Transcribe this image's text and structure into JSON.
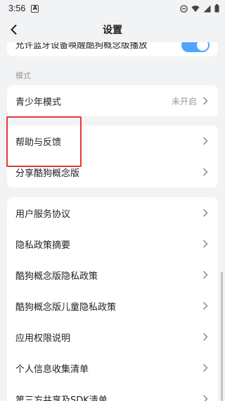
{
  "status_bar": {
    "time": "3:56",
    "alert_glyph": "A"
  },
  "header": {
    "title": "设置"
  },
  "partial_row": {
    "label": "允许蓝牙设备唤醒酷狗概念版播放"
  },
  "mode_section": {
    "label": "模式"
  },
  "teen_mode": {
    "label": "青少年模式",
    "value": "未开启"
  },
  "help_group": {
    "items": [
      "帮助与反馈",
      "分享酷狗概念版"
    ]
  },
  "legal_group": {
    "items": [
      "用户服务协议",
      "隐私政策摘要",
      "酷狗概念版隐私政策",
      "酷狗概念版儿童隐私政策",
      "应用权限说明",
      "个人信息收集清单",
      "第三方共享及SDK清单"
    ]
  },
  "colors": {
    "toggle_on": "#4fa6ff",
    "highlight": "#e53935",
    "background": "#f2f3f5"
  }
}
